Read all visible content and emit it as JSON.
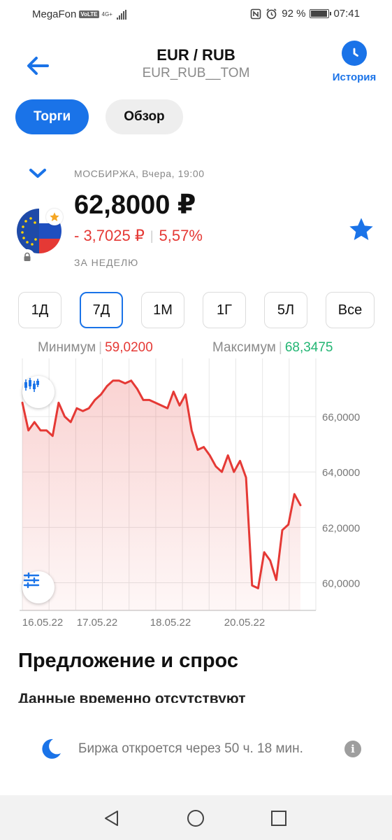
{
  "status_bar": {
    "carrier": "MegaFon",
    "volte": "VoLTE",
    "network": "4G+",
    "battery": "92 %",
    "battery_level": 0.92,
    "time": "07:41"
  },
  "header": {
    "title": "EUR / RUB",
    "ticker": "EUR_RUB__TOM",
    "history_label": "История"
  },
  "tabs": [
    {
      "label": "Торги",
      "active": true
    },
    {
      "label": "Обзор",
      "active": false
    }
  ],
  "quote": {
    "exchange_time": "МОСБИРЖА, Вчера, 19:00",
    "price": "62,8000 ₽",
    "change_abs": "- 3,7025 ₽",
    "change_sep": "|",
    "change_pct": "5,57%",
    "period_label": "ЗА НЕДЕЛЮ"
  },
  "periods": [
    {
      "label": "1Д",
      "active": false
    },
    {
      "label": "7Д",
      "active": true
    },
    {
      "label": "1М",
      "active": false
    },
    {
      "label": "1Г",
      "active": false
    },
    {
      "label": "5Л",
      "active": false
    },
    {
      "label": "Все",
      "active": false
    }
  ],
  "range": {
    "min_label": "Минимум",
    "min_value": "59,0200",
    "max_label": "Максимум",
    "max_value": "68,3475",
    "sep": "|"
  },
  "chart_data": {
    "type": "area",
    "x": [
      "16.05.22",
      "17.05.22",
      "18.05.22",
      "20.05.22"
    ],
    "values": [
      66.5,
      65.5,
      65.8,
      65.5,
      65.5,
      65.3,
      66.5,
      66.0,
      65.8,
      66.3,
      66.2,
      66.3,
      66.6,
      66.8,
      67.1,
      67.3,
      67.3,
      67.2,
      67.3,
      67.0,
      66.6,
      66.6,
      66.5,
      66.4,
      66.3,
      66.9,
      66.4,
      66.8,
      65.5,
      64.8,
      64.9,
      64.6,
      64.2,
      64.0,
      64.6,
      64.0,
      64.4,
      63.8,
      59.9,
      59.8,
      61.1,
      60.8,
      60.1,
      61.9,
      62.1,
      63.2,
      62.8
    ],
    "yticks": [
      "66,0000",
      "64,0000",
      "62,0000",
      "60,0000"
    ],
    "ytick_values": [
      66,
      64,
      62,
      60
    ],
    "ylim": [
      59.0,
      68.0
    ],
    "line_color": "#e53935",
    "grid": true
  },
  "orderbook": {
    "title": "Предложение и спрос",
    "subtitle": "Данные временно отсутствуют"
  },
  "notice": {
    "text": "Биржа откроется через 50 ч. 18 мин.",
    "info": "i"
  },
  "colors": {
    "accent": "#1a73e8",
    "negative": "#e53935",
    "positive": "#22b573"
  }
}
